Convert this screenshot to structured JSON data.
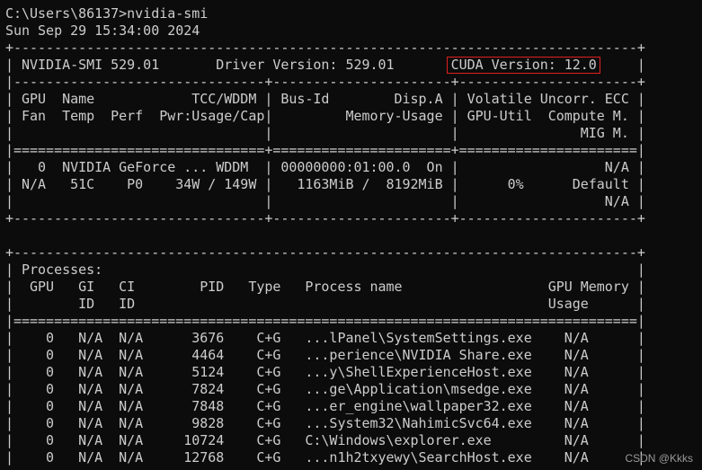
{
  "highlight": {
    "color": "#e02020"
  },
  "terminal": {
    "background": "#0c0c0c",
    "foreground": "#cccccc",
    "lines": [
      "C:\\Users\\86137>nvidia-smi",
      "Sun Sep 29 15:34:00 2024",
      "+-----------------------------------------------------------------------------+",
      "| NVIDIA-SMI 529.01       Driver Version: 529.01       CUDA Version: 12.0     |",
      "|-------------------------------+----------------------+----------------------+",
      "| GPU  Name            TCC/WDDM | Bus-Id        Disp.A | Volatile Uncorr. ECC |",
      "| Fan  Temp  Perf  Pwr:Usage/Cap|         Memory-Usage | GPU-Util  Compute M. |",
      "|                               |                      |               MIG M. |",
      "|===============================+======================+======================|",
      "|   0  NVIDIA GeForce ... WDDM  | 00000000:01:00.0  On |                  N/A |",
      "| N/A   51C    P0    34W / 149W |   1163MiB /  8192MiB |      0%      Default |",
      "|                               |                      |                  N/A |",
      "+-------------------------------+----------------------+----------------------+",
      "",
      "+-----------------------------------------------------------------------------+",
      "| Processes:                                                                  |",
      "|  GPU   GI   CI        PID   Type   Process name                  GPU Memory |",
      "|        ID   ID                                                   Usage      |",
      "|=============================================================================|",
      "|    0   N/A  N/A      3676    C+G   ...lPanel\\SystemSettings.exe    N/A      |",
      "|    0   N/A  N/A      4464    C+G   ...perience\\NVIDIA Share.exe    N/A      |",
      "|    0   N/A  N/A      5124    C+G   ...y\\ShellExperienceHost.exe    N/A      |",
      "|    0   N/A  N/A      7824    C+G   ...ge\\Application\\msedge.exe    N/A      |",
      "|    0   N/A  N/A      7848    C+G   ...er_engine\\wallpaper32.exe    N/A      |",
      "|    0   N/A  N/A      9828    C+G   ...System32\\NahimicSvc64.exe    N/A      |",
      "|    0   N/A  N/A     10724    C+G   C:\\Windows\\explorer.exe         N/A      |",
      "|    0   N/A  N/A     12768    C+G   ...n1h2txyewy\\SearchHost.exe    N/A      |"
    ]
  },
  "watermark": "CSDN @Kkks"
}
